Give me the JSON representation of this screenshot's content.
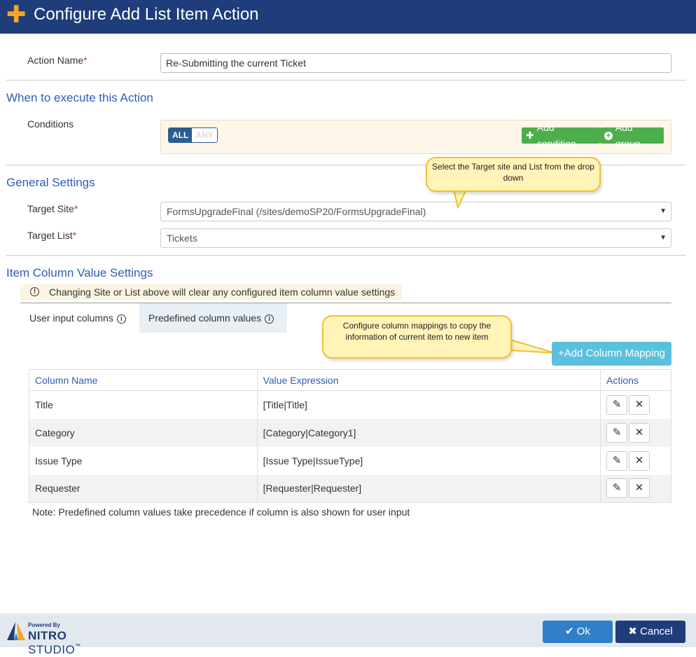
{
  "header": {
    "title": "Configure Add List Item Action"
  },
  "action_name": {
    "label": "Action Name",
    "required_mark": "*",
    "value": "Re-Submitting the current Ticket"
  },
  "when_section": {
    "title": "When to execute this Action",
    "conditions_label": "Conditions",
    "toggle": {
      "all": "ALL",
      "any": "ANY",
      "selected": "ALL"
    },
    "add_condition": "Add condition",
    "add_group": "Add group"
  },
  "general_section": {
    "title": "General Settings",
    "target_site": {
      "label": "Target Site",
      "value": "FormsUpgradeFinal (/sites/demoSP20/FormsUpgradeFinal)"
    },
    "target_list": {
      "label": "Target List",
      "value": "Tickets"
    },
    "callout": "Select the Target site and List from the drop down"
  },
  "item_section": {
    "title": "Item Column Value Settings",
    "warning": "Changing Site or List above will clear any configured item column value settings",
    "tabs": [
      {
        "label": "User input columns",
        "active": false
      },
      {
        "label": "Predefined column values",
        "active": true
      }
    ],
    "callout": "Configure column mappings to copy the information of current item to new item",
    "add_mapping": "Add Column Mapping",
    "columns": [
      "Column Name",
      "Value Expression",
      "Actions"
    ],
    "rows": [
      {
        "name": "Title",
        "expr": "[Title|Title]"
      },
      {
        "name": "Category",
        "expr": "[Category|Category1]"
      },
      {
        "name": "Issue Type",
        "expr": "[Issue Type|IssueType]"
      },
      {
        "name": "Requester",
        "expr": "[Requester|Requester]"
      }
    ],
    "note": "Note: Predefined column values take precedence if column is also shown for user input"
  },
  "footer": {
    "powered_by": "Powered By",
    "brand_nitro": "NITRO",
    "brand_studio": "STUDIO",
    "brand_tm": "™",
    "ok": "Ok",
    "cancel": "Cancel"
  },
  "colors": {
    "header": "#1f3d7a",
    "accent_plus": "#f5a623",
    "section_title": "#2e5cb8",
    "green": "#4cae4c",
    "info_button": "#5bc0de",
    "ok_button": "#2f80c8",
    "required": "#c9302c"
  }
}
